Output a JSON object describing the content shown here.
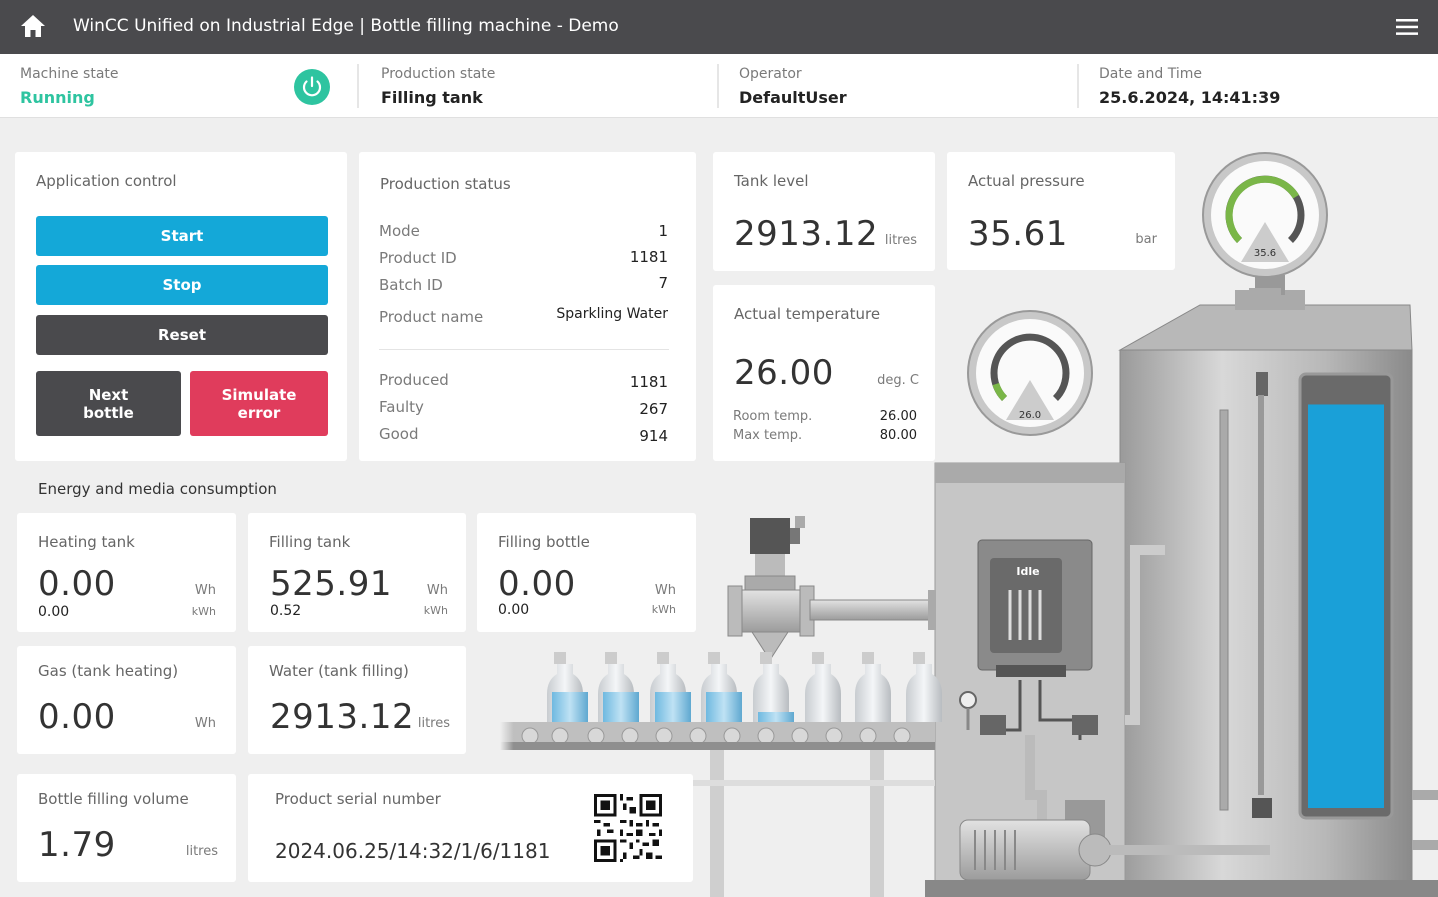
{
  "header": {
    "title": "WinCC Unified on Industrial Edge  |  Bottle filling machine - Demo"
  },
  "status": {
    "machine_state_label": "Machine state",
    "machine_state_value": "Running",
    "production_state_label": "Production state",
    "production_state_value": "Filling tank",
    "operator_label": "Operator",
    "operator_value": "DefaultUser",
    "datetime_label": "Date and Time",
    "datetime_value": "25.6.2024, 14:41:39"
  },
  "app_control": {
    "title": "Application control",
    "start": "Start",
    "stop": "Stop",
    "reset": "Reset",
    "next_bottle_1": "Next",
    "next_bottle_2": "bottle",
    "simulate_error_1": "Simulate",
    "simulate_error_2": "error"
  },
  "production_status": {
    "title": "Production status",
    "mode_label": "Mode",
    "mode_value": "1",
    "product_id_label": "Product ID",
    "product_id_value": "1181",
    "batch_id_label": "Batch ID",
    "batch_id_value": "7",
    "product_name_label": "Product name",
    "product_name_value": "Sparkling Water",
    "produced_label": "Produced",
    "produced_value": "1181",
    "faulty_label": "Faulty",
    "faulty_value": "267",
    "good_label": "Good",
    "good_value": "914"
  },
  "tank_level": {
    "title": "Tank level",
    "value": "2913.12",
    "unit": "litres"
  },
  "actual_pressure": {
    "title": "Actual pressure",
    "value": "35.61",
    "unit": "bar"
  },
  "actual_temperature": {
    "title": "Actual temperature",
    "value": "26.00",
    "unit": "deg. C",
    "room_label": "Room temp.",
    "room_value": "26.00",
    "max_label": "Max temp.",
    "max_value": "80.00"
  },
  "energy": {
    "title": "Energy and media consumption",
    "heating_tank": {
      "title": "Heating tank",
      "value": "0.00",
      "unit": "Wh",
      "sub_value": "0.00",
      "sub_unit": "kWh"
    },
    "filling_tank": {
      "title": "Filling tank",
      "value": "525.91",
      "unit": "Wh",
      "sub_value": "0.52",
      "sub_unit": "kWh"
    },
    "filling_bottle": {
      "title": "Filling bottle",
      "value": "0.00",
      "unit": "Wh",
      "sub_value": "0.00",
      "sub_unit": "kWh"
    },
    "gas": {
      "title": "Gas (tank heating)",
      "value": "0.00",
      "unit": "Wh"
    },
    "water": {
      "title": "Water (tank filling)",
      "value": "2913.12",
      "unit": "litres"
    }
  },
  "bottle_volume": {
    "title": "Bottle filling volume",
    "value": "1.79",
    "unit": "litres"
  },
  "serial": {
    "title": "Product serial number",
    "value": "2024.06.25/14:32/1/6/1181"
  },
  "gauges": {
    "pressure_gauge": {
      "reading": "35.6",
      "fraction": 0.72,
      "color": "#7ab648"
    },
    "temperature_gauge": {
      "reading": "26.0",
      "fraction": 0.1,
      "color": "#7ab648"
    }
  },
  "machine": {
    "controller_status": "Idle",
    "tank_fill_fraction": 0.97,
    "liquid_color": "#1aa0d8"
  },
  "colors": {
    "accent_blue": "#14a8d8",
    "dark": "#4a4a4d",
    "danger": "#e03c5c",
    "running": "#2ec4a0"
  }
}
